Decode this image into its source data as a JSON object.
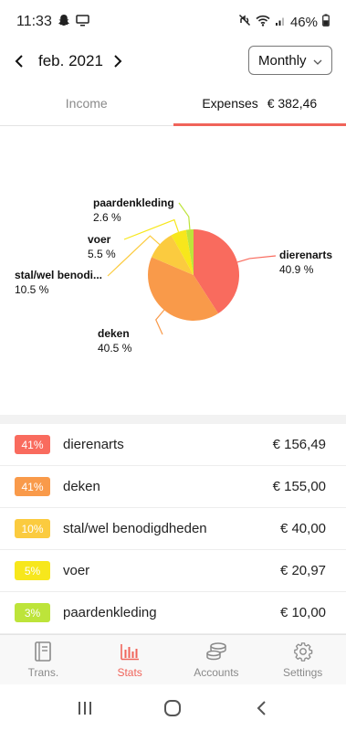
{
  "status_bar": {
    "time": "11:33",
    "battery": "46%",
    "icons": [
      "snapchat-icon",
      "screen-cast-icon",
      "mute-icon",
      "wifi-icon",
      "signal-icon",
      "battery-icon"
    ]
  },
  "header": {
    "period": "feb. 2021",
    "period_type": "Monthly"
  },
  "tabs": {
    "income_label": "Income",
    "expenses_label": "Expenses",
    "expenses_total": "€ 382,46"
  },
  "chart_data": {
    "type": "pie",
    "slices": [
      {
        "name": "dierenarts",
        "percent": 40.9,
        "label_pct": "40.9 %",
        "color": "#f96b5e"
      },
      {
        "name": "deken",
        "percent": 40.5,
        "label_pct": "40.5 %",
        "color": "#f99a4a"
      },
      {
        "name": "stal/wel benodi...",
        "percent": 10.5,
        "label_pct": "10.5 %",
        "color": "#fbcb3f"
      },
      {
        "name": "voer",
        "percent": 5.5,
        "label_pct": "5.5 %",
        "color": "#f7e71c"
      },
      {
        "name": "paardenkleding",
        "percent": 2.6,
        "label_pct": "2.6 %",
        "color": "#bde43a"
      }
    ]
  },
  "list": [
    {
      "badge": "41%",
      "color": "#f96b5e",
      "name": "dierenarts",
      "amount": "€ 156,49"
    },
    {
      "badge": "41%",
      "color": "#f99a4a",
      "name": "deken",
      "amount": "€ 155,00"
    },
    {
      "badge": "10%",
      "color": "#fbcb3f",
      "name": "stal/wel benodigdheden",
      "amount": "€ 40,00"
    },
    {
      "badge": "5%",
      "color": "#f7e71c",
      "name": "voer",
      "amount": "€ 20,97"
    },
    {
      "badge": "3%",
      "color": "#bde43a",
      "name": "paardenkleding",
      "amount": "€ 10,00"
    }
  ],
  "bottom_nav": {
    "trans": "Trans.",
    "stats": "Stats",
    "accounts": "Accounts",
    "settings": "Settings"
  },
  "colors": {
    "accent": "#f0645a"
  }
}
